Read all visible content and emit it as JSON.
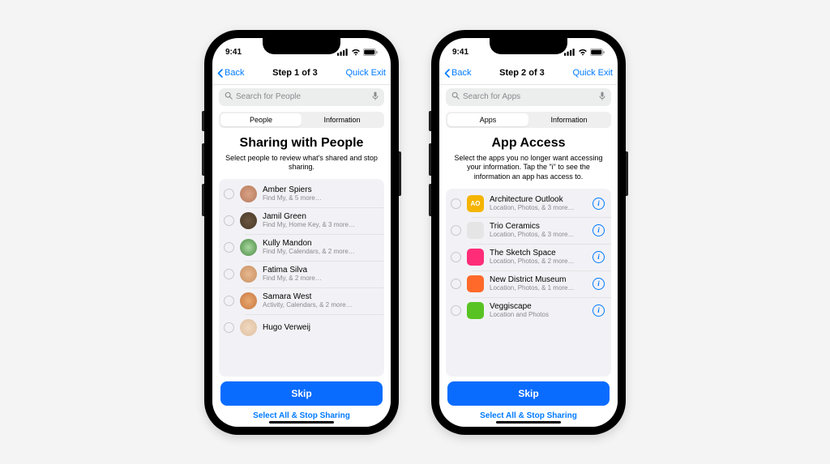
{
  "status": {
    "time": "9:41"
  },
  "left": {
    "nav": {
      "back": "Back",
      "title": "Step 1 of 3",
      "exit": "Quick Exit"
    },
    "search_placeholder": "Search for People",
    "seg": {
      "a": "People",
      "b": "Information"
    },
    "heading": "Sharing with People",
    "sub": "Select people to review what's shared and stop sharing.",
    "rows": [
      {
        "name": "Amber Spiers",
        "detail": "Find My, & 5 more…"
      },
      {
        "name": "Jamil Green",
        "detail": "Find My, Home Key, & 3 more…"
      },
      {
        "name": "Kully Mandon",
        "detail": "Find My, Calendars, & 2 more…"
      },
      {
        "name": "Fatima Silva",
        "detail": "Find My, & 2 more…"
      },
      {
        "name": "Samara West",
        "detail": "Activity, Calendars, & 2 more…"
      },
      {
        "name": "Hugo Verweij",
        "detail": ""
      }
    ],
    "skip": "Skip",
    "select_all": "Select All & Stop Sharing"
  },
  "right": {
    "nav": {
      "back": "Back",
      "title": "Step 2 of 3",
      "exit": "Quick Exit"
    },
    "search_placeholder": "Search for Apps",
    "seg": {
      "a": "Apps",
      "b": "Information"
    },
    "heading": "App Access",
    "sub": "Select the apps you no longer want accessing your information. Tap the \"i\" to see the information an app has access to.",
    "rows": [
      {
        "name": "Architecture Outlook",
        "detail": "Location, Photos, & 3 more…",
        "color": "#f5b400",
        "label": "AO"
      },
      {
        "name": "Trio Ceramics",
        "detail": "Location, Photos, & 3 more…",
        "color": "#e5e5e5",
        "label": ""
      },
      {
        "name": "The Sketch Space",
        "detail": "Location, Photos, & 2 more…",
        "color": "#ff2d78",
        "label": ""
      },
      {
        "name": "New District Museum",
        "detail": "Location, Photos, & 1 more…",
        "color": "#ff6a2a",
        "label": ""
      },
      {
        "name": "Veggiscape",
        "detail": "Location and Photos",
        "color": "#58c322",
        "label": ""
      }
    ],
    "skip": "Skip",
    "select_all": "Select All & Stop Sharing"
  }
}
